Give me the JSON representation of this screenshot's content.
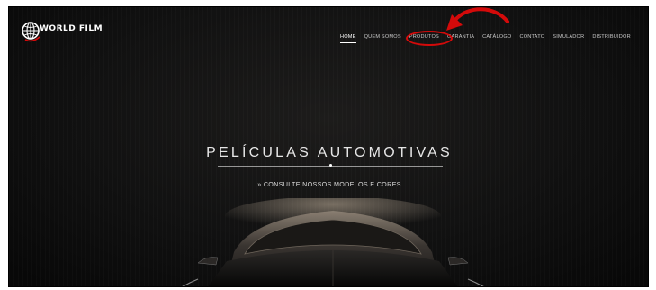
{
  "brand": {
    "logo_text": "WORLD FILM",
    "logo_icon": "globe-icon"
  },
  "nav": {
    "items": [
      {
        "label": "HOME",
        "active": true
      },
      {
        "label": "QUEM SOMOS",
        "active": false
      },
      {
        "label": "PRODUTOS",
        "active": false,
        "highlighted": true
      },
      {
        "label": "GARANTIA",
        "active": false
      },
      {
        "label": "CATÁLOGO",
        "active": false
      },
      {
        "label": "CONTATO",
        "active": false
      },
      {
        "label": "SIMULADOR",
        "active": false
      },
      {
        "label": "DISTRIBUIDOR",
        "active": false
      }
    ]
  },
  "hero": {
    "title": "PELÍCULAS AUTOMOTIVAS",
    "link_label": "» CONSULTE NOSSOS MODELOS E CORES"
  },
  "annotation": {
    "color": "#d40a0a",
    "arrow_icon": "curved-arrow-icon"
  },
  "colors": {
    "background": "#111111",
    "text": "#ffffff",
    "accent": "#d40a0a"
  }
}
